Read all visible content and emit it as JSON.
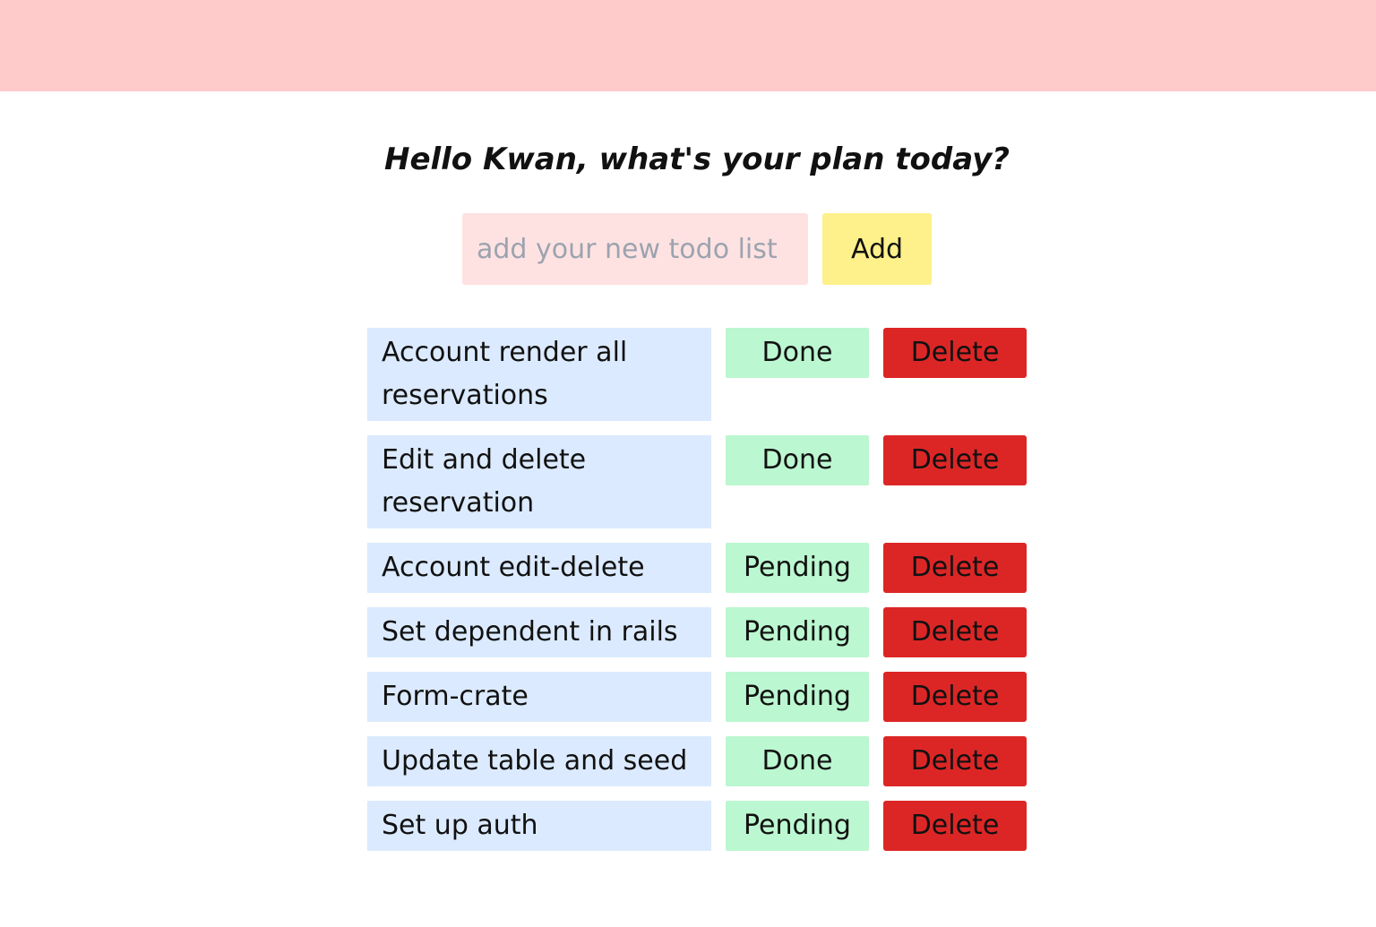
{
  "greeting": "Hello Kwan, what's your plan today?",
  "new_todo": {
    "value": "",
    "placeholder": "add your new todo list",
    "add_label": "Add"
  },
  "todos": [
    {
      "text": "Account render all reservations",
      "status": "Done",
      "delete_label": "Delete"
    },
    {
      "text": "Edit and delete reservation",
      "status": "Done",
      "delete_label": "Delete"
    },
    {
      "text": "Account edit-delete",
      "status": "Pending",
      "delete_label": "Delete"
    },
    {
      "text": "Set dependent in rails",
      "status": "Pending",
      "delete_label": "Delete"
    },
    {
      "text": "Form-crate",
      "status": "Pending",
      "delete_label": "Delete"
    },
    {
      "text": "Update table and seed",
      "status": "Done",
      "delete_label": "Delete"
    },
    {
      "text": "Set up auth",
      "status": "Pending",
      "delete_label": "Delete"
    }
  ],
  "colors": {
    "banner": "#fecaca",
    "input_bg": "#fee2e2",
    "add_button": "#fef08a",
    "todo_bg": "#dbeafe",
    "status_button": "#bbf7d0",
    "delete_button": "#dc2626"
  }
}
